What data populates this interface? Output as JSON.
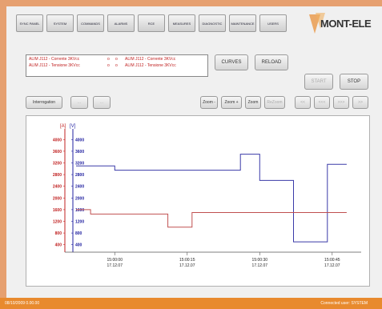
{
  "nav": {
    "items": [
      {
        "label": "SYNC PANEL"
      },
      {
        "label": "SYSTEM"
      },
      {
        "label": "COMMANDS"
      },
      {
        "label": "ALARMS"
      },
      {
        "label": "RCE"
      },
      {
        "label": "MEASURES"
      },
      {
        "label": "DIAGNOSTIC"
      },
      {
        "label": "MAINTENANCE"
      },
      {
        "label": "USERS"
      }
    ]
  },
  "logo": {
    "text": "MONT-ELE"
  },
  "signals": {
    "rows": [
      {
        "name": "ALIM J112 - Corrente 3KVcc",
        "a": "o",
        "b": "o",
        "desc": "ALIM J112 - Corrente 3KVcc"
      },
      {
        "name": "ALIM J112 - Tensione 3KVcc",
        "a": "o",
        "b": "o",
        "desc": "ALIM J112 - Tensione 3KVcc"
      }
    ]
  },
  "buttons": {
    "curves": "CURVES",
    "reload": "RELOAD",
    "start": "START",
    "stop": "STOP",
    "interrogation": "Interrogation",
    "blank1": "...",
    "blank2": "...",
    "zoom_minus": "Zoom -",
    "zoom_plus": "Zoom +",
    "zoom": "Zoom",
    "rezoom": "ReZoom",
    "nav1": "<<",
    "nav2": "<<<",
    "nav3": ">>>",
    "nav4": ">>"
  },
  "chart_data": {
    "type": "line",
    "axis_units": {
      "left": "[A]",
      "right": "[V]"
    },
    "left_ticks": [
      "4000",
      "3600",
      "3200",
      "2800",
      "2400",
      "2000",
      "1600",
      "1200",
      "800",
      "400"
    ],
    "right_ticks": [
      "4000",
      "3600",
      "3200",
      "2800",
      "2400",
      "2000",
      "1600",
      "1200",
      "800",
      "400"
    ],
    "x_ticks": [
      {
        "time": "15:00:00",
        "date": "17.12.07"
      },
      {
        "time": "15:00:15",
        "date": "17.12.07"
      },
      {
        "time": "15:00:30",
        "date": "17.12.07"
      },
      {
        "time": "15:00:45",
        "date": "17.12.07"
      }
    ],
    "x_range": [
      -8,
      51
    ],
    "y_range": [
      200,
      4200
    ],
    "series": [
      {
        "color": "#3a3aa8",
        "points": [
          [
            -8,
            3100
          ],
          [
            0,
            3100
          ],
          [
            0,
            2950
          ],
          [
            26,
            2950
          ],
          [
            26,
            3500
          ],
          [
            30,
            3500
          ],
          [
            30,
            2600
          ],
          [
            37,
            2600
          ],
          [
            37,
            500
          ],
          [
            44,
            500
          ],
          [
            44,
            3150
          ],
          [
            48,
            3150
          ]
        ]
      },
      {
        "color": "#c05050",
        "points": [
          [
            -8,
            1600
          ],
          [
            -5,
            1600
          ],
          [
            -5,
            1450
          ],
          [
            11,
            1450
          ],
          [
            11,
            1000
          ],
          [
            16,
            1000
          ],
          [
            16,
            1500
          ],
          [
            48,
            1500
          ]
        ]
      }
    ]
  },
  "status": {
    "left": "08/10/2009   0.00.00",
    "right": "Connected user:    SYSTEM"
  },
  "colors": {
    "accent": "#e88a2e",
    "axis_left": "#c02020",
    "axis_right": "#2020a0"
  }
}
